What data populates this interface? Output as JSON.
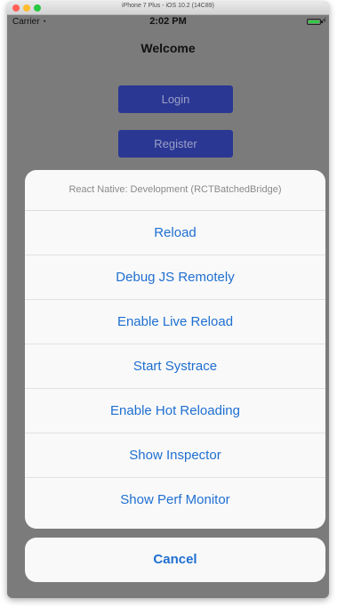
{
  "window": {
    "title": "iPhone 7 Plus - iOS 10.2 (14C89)"
  },
  "status_bar": {
    "carrier": "Carrier",
    "time": "2:02 PM"
  },
  "nav": {
    "title": "Welcome"
  },
  "buttons": {
    "login": "Login",
    "register": "Register"
  },
  "action_sheet": {
    "title": "React Native: Development (RCTBatchedBridge)",
    "items": [
      "Reload",
      "Debug JS Remotely",
      "Enable Live Reload",
      "Start Systrace",
      "Enable Hot Reloading",
      "Show Inspector",
      "Show Perf Monitor"
    ],
    "cancel": "Cancel"
  },
  "colors": {
    "accent": "#1f6fd1",
    "app_button": "#2a3793",
    "dim_background": "#7b7b7b"
  }
}
